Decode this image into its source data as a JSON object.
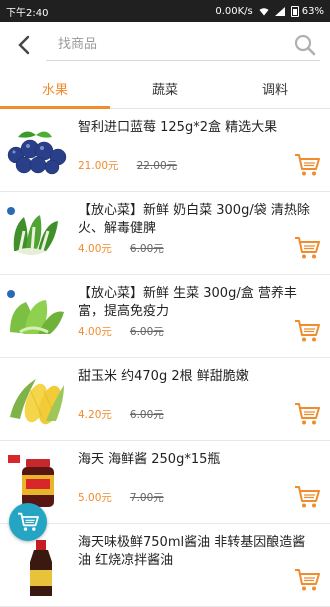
{
  "status": {
    "time": "下午2:40",
    "speed": "0.00K/s",
    "battery": "63%"
  },
  "search": {
    "placeholder": "找商品"
  },
  "tabs": [
    {
      "label": "水果",
      "active": true
    },
    {
      "label": "蔬菜",
      "active": false
    },
    {
      "label": "调料",
      "active": false
    }
  ],
  "products": [
    {
      "title": "智利进口蓝莓 125g*2盒 精选大果",
      "price": "21.00元",
      "old_price": "22.00元",
      "image": "blueberries"
    },
    {
      "title": "【放心菜】新鲜 奶白菜 300g/袋 清热除火、解毒健脾",
      "price": "4.00元",
      "old_price": "6.00元",
      "image": "bok-choy"
    },
    {
      "title": "【放心菜】新鲜 生菜 300g/盒 营养丰富，提高免疫力",
      "price": "4.00元",
      "old_price": "6.00元",
      "image": "lettuce"
    },
    {
      "title": "甜玉米 约470g 2根 鲜甜脆嫩",
      "price": "4.20元",
      "old_price": "6.00元",
      "image": "corn"
    },
    {
      "title": "海天 海鲜酱 250g*15瓶",
      "price": "5.00元",
      "old_price": "7.00元",
      "image": "seafood-sauce-jar"
    },
    {
      "title": "海天味极鲜750ml酱油 非转基因酿造酱油 红烧凉拌酱油",
      "price": "",
      "old_price": "",
      "image": "soy-sauce-bottle"
    }
  ],
  "colors": {
    "accent": "#f08c2e",
    "fab": "#24a5c4",
    "statusbar": "#202020"
  }
}
